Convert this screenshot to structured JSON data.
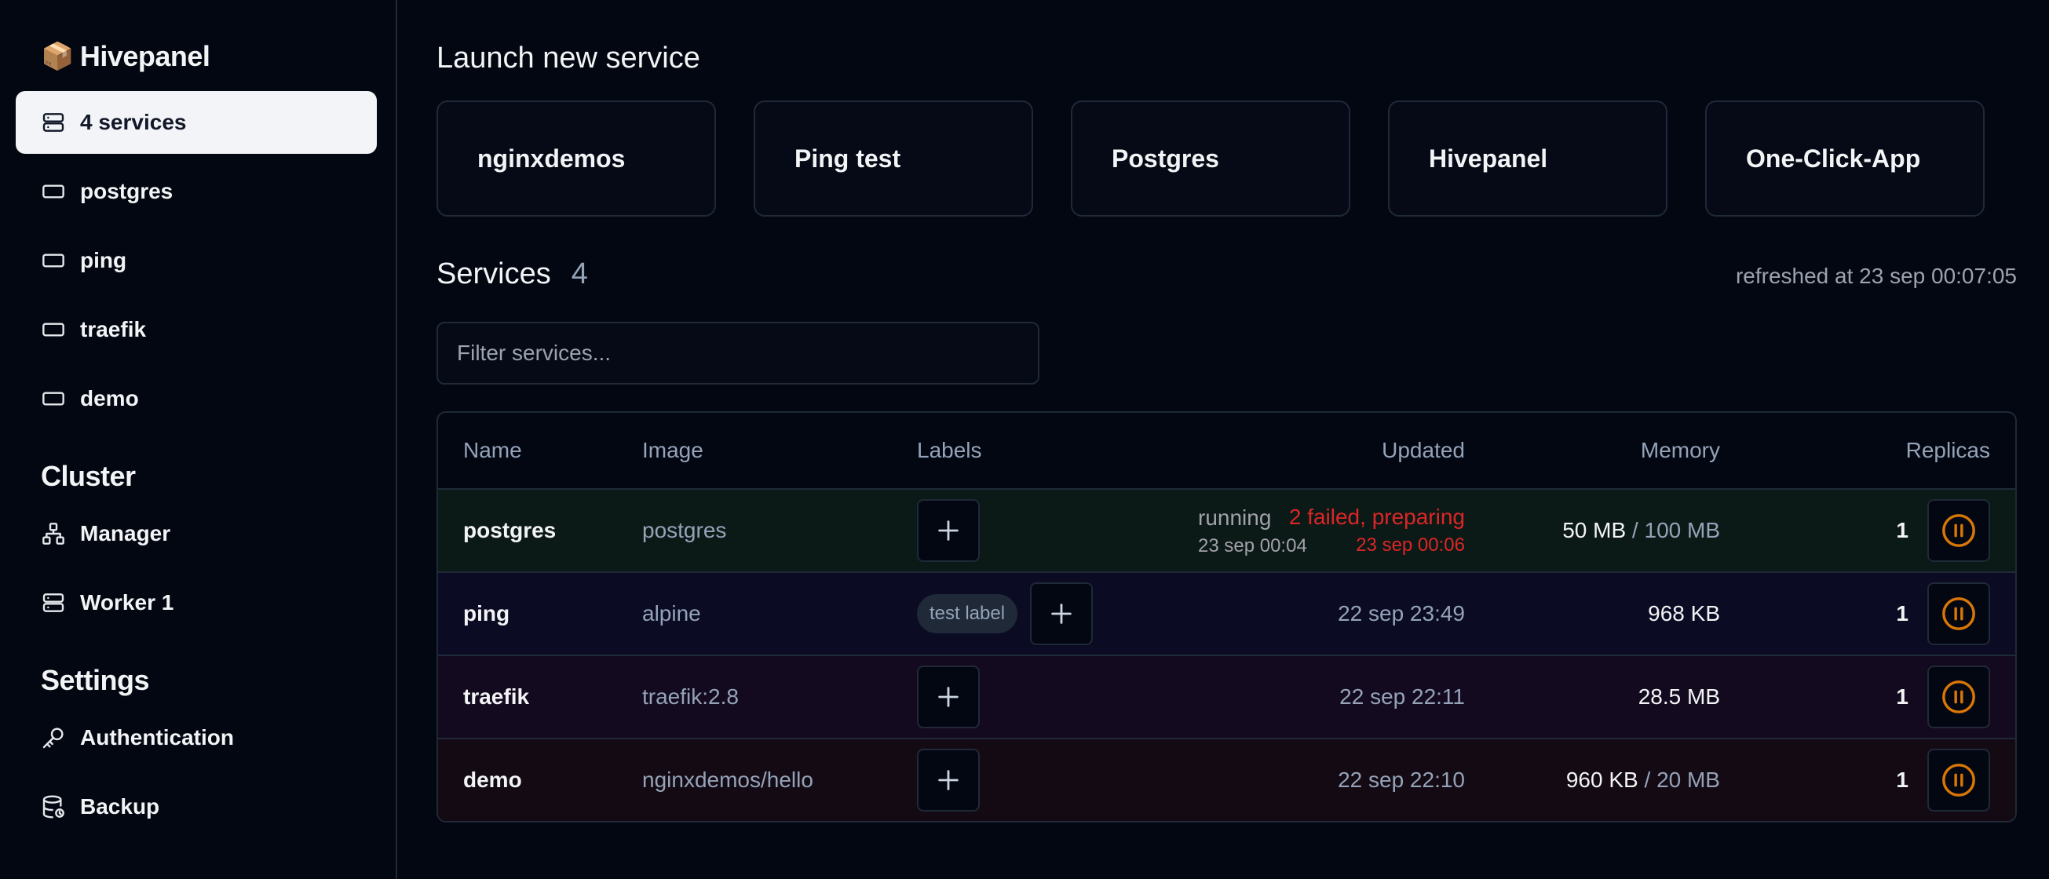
{
  "brand": {
    "name": "Hivepanel",
    "logo": "📦"
  },
  "sidebar": {
    "services_item": "4 services",
    "services": [
      "postgres",
      "ping",
      "traefik",
      "demo"
    ],
    "cluster_title": "Cluster",
    "cluster_items": [
      "Manager",
      "Worker 1"
    ],
    "settings_title": "Settings",
    "settings_items": [
      "Authentication",
      "Backup"
    ]
  },
  "launch": {
    "title": "Launch new service",
    "templates": [
      "nginxdemos",
      "Ping test",
      "Postgres",
      "Hivepanel",
      "One-Click-App"
    ]
  },
  "services": {
    "title": "Services",
    "count": "4",
    "refreshed": "refreshed at 23 sep 00:07:05",
    "filter_placeholder": "Filter services...",
    "columns": {
      "name": "Name",
      "image": "Image",
      "labels": "Labels",
      "updated": "Updated",
      "memory": "Memory",
      "replicas": "Replicas"
    },
    "rows": [
      {
        "name": "postgres",
        "image": "postgres",
        "status": "running",
        "status_time": "23 sep 00:04",
        "updated": "2 failed, preparing",
        "updated_sub": "23 sep 00:06",
        "memory_used": "50 MB",
        "memory_limit": "100 MB",
        "replicas": "1"
      },
      {
        "name": "ping",
        "image": "alpine",
        "label": "test label",
        "updated": "22 sep 23:49",
        "memory_used": "968 KB",
        "replicas": "1"
      },
      {
        "name": "traefik",
        "image": "traefik:2.8",
        "updated": "22 sep 22:11",
        "memory_used": "28.5 MB",
        "replicas": "1"
      },
      {
        "name": "demo",
        "image": "nginxdemos/hello",
        "updated": "22 sep 22:10",
        "memory_used": "960 KB",
        "memory_limit": "20 MB",
        "replicas": "1"
      }
    ]
  },
  "colors": {
    "background": "#030712",
    "pause_icon": "#d97706",
    "error": "#dc2626"
  }
}
